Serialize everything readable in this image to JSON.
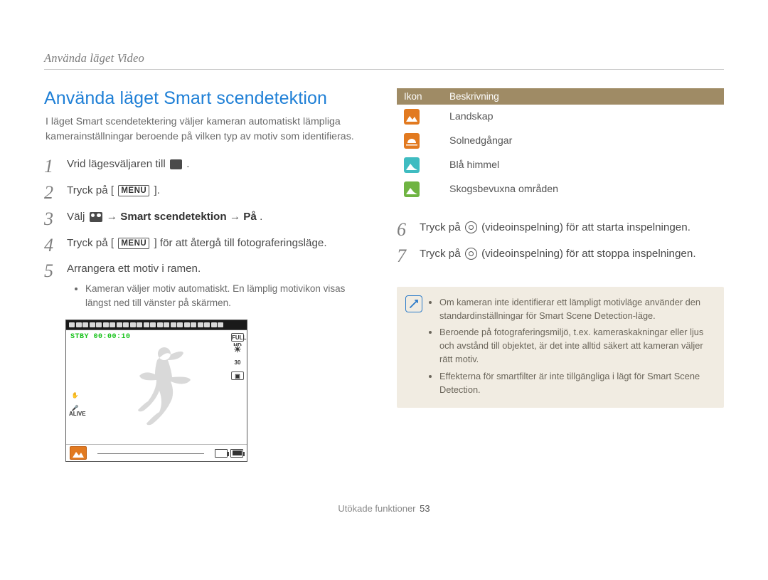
{
  "breadcrumb": "Använda läget Video",
  "title": "Använda läget Smart scendetektion",
  "intro": "I läget Smart scendetektering väljer kameran automatiskt lämpliga kamerainställningar beroende på vilken typ av motiv som identifieras.",
  "steps_left": {
    "s1_a": "Vrid lägesväljaren till ",
    "s1_b": ".",
    "s2_a": "Tryck på [",
    "s2_b": "].",
    "menu_label": "MENU",
    "s3_a": "Välj ",
    "s3_b": " → ",
    "s3_bold1": "Smart scendetektion",
    "s3_bold2": "På",
    "s3_c": ".",
    "s4_a": "Tryck på [",
    "s4_b": "] för att återgå till fotograferingsläge.",
    "s5": "Arrangera ett motiv i ramen.",
    "s5_bullet": "Kameran väljer motiv automatiskt. En lämplig motivikon visas längst ned till vänster på skärmen."
  },
  "camera": {
    "stby": "STBY 00:00:10",
    "right_icons": [
      "FULL HD",
      "☀",
      "30",
      "▣"
    ],
    "left_icons": [
      "✋",
      "🎤 ALIVE"
    ]
  },
  "table": {
    "headers": [
      "Ikon",
      "Beskrivning"
    ],
    "rows": [
      {
        "color": "orange",
        "svg": "landscape",
        "label": "Landskap"
      },
      {
        "color": "orange",
        "svg": "sunset",
        "label": "Solnedgångar"
      },
      {
        "color": "teal",
        "svg": "sky",
        "label": "Blå himmel"
      },
      {
        "color": "green",
        "svg": "forest",
        "label": "Skogsbevuxna områden"
      }
    ]
  },
  "steps_right": {
    "s6_a": "Tryck på ",
    "s6_b": " (videoinspelning) för att starta inspelningen.",
    "s7_a": "Tryck på ",
    "s7_b": " (videoinspelning) för att stoppa inspelningen."
  },
  "notes": [
    "Om kameran inte identifierar ett lämpligt motivläge använder den standardinställningar för Smart Scene Detection-läge.",
    "Beroende på fotograferingsmiljö, t.ex. kameraskakningar eller ljus och avstånd till objektet, är det inte alltid säkert att kameran väljer rätt motiv.",
    "Effekterna för smartfilter är inte tillgängliga i lägt för Smart Scene Detection."
  ],
  "footer_label": "Utökade funktioner",
  "footer_page": "53"
}
